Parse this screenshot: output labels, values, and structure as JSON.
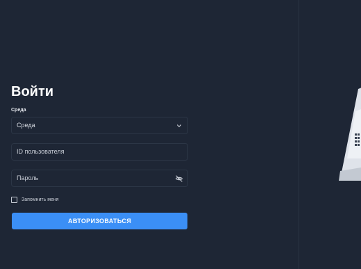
{
  "login": {
    "title": "Войти",
    "environment_label": "Среда",
    "environment_value": "Среда",
    "user_id_placeholder": "ID пользователя",
    "password_placeholder": "Пароль",
    "remember_label": "Запомнить меня",
    "submit_label": "АВТОРИЗОВАТЬСЯ"
  },
  "icons": {
    "environment_dropdown": "chevron-down-icon",
    "password_toggle": "eye-off-icon",
    "illustration": "laptop-illustration"
  },
  "colors": {
    "background": "#1e2635",
    "field_border": "#2c3646",
    "accent": "#3b8ff6",
    "text": "#ffffff"
  }
}
